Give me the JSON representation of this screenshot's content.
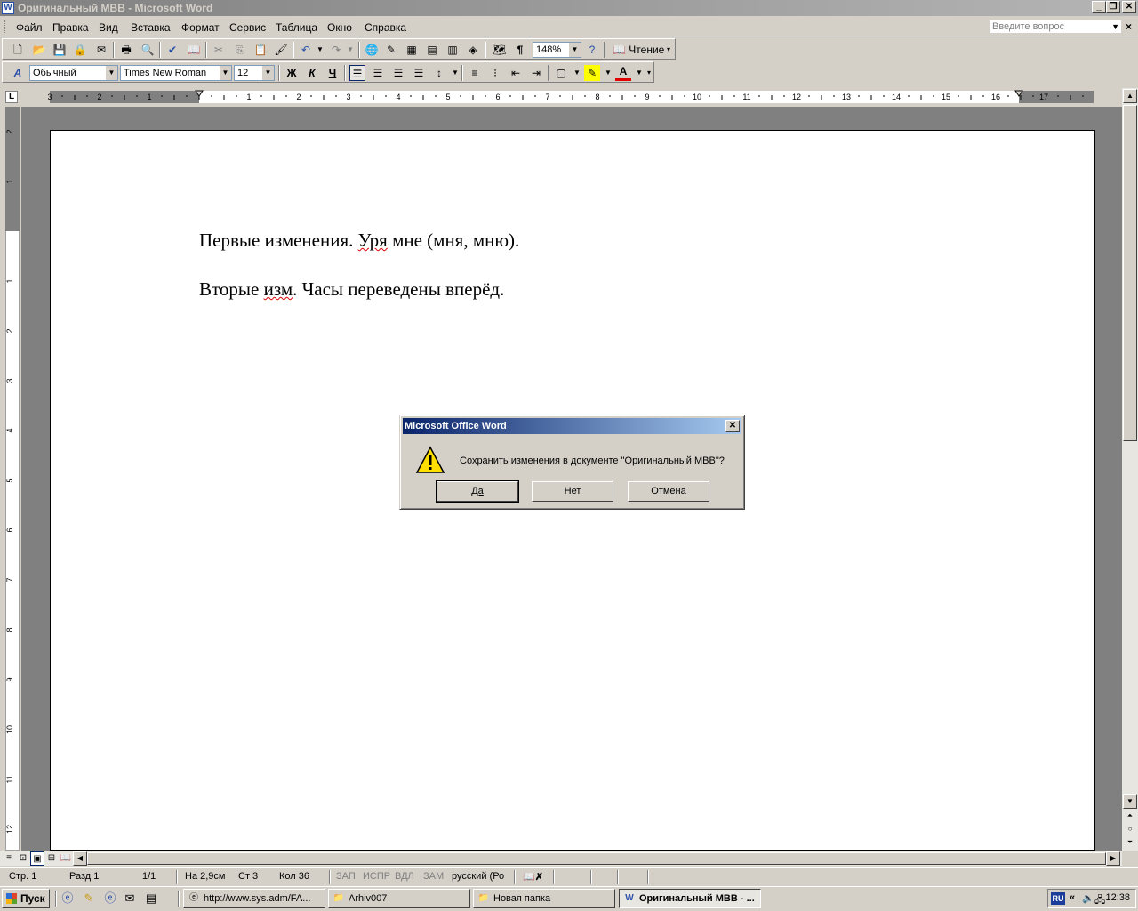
{
  "window": {
    "title": "Оригинальный МВВ - Microsoft Word",
    "icon": "word-icon"
  },
  "menu": {
    "items": [
      "Файл",
      "Правка",
      "Вид",
      "Вставка",
      "Формат",
      "Сервис",
      "Таблица",
      "Окно",
      "Справка"
    ],
    "help_placeholder": "Введите вопрос"
  },
  "toolbar_standard": {
    "zoom": "148%",
    "read_label": "Чтение"
  },
  "toolbar_format": {
    "style": "Обычный",
    "font": "Times New Roman",
    "size": "12",
    "bold": "Ж",
    "italic": "К",
    "underline": "Ч"
  },
  "ruler": {
    "h_labels": [
      "3",
      "2",
      "1",
      "1",
      "2",
      "3",
      "4",
      "5",
      "6",
      "7",
      "8",
      "9",
      "10",
      "11",
      "12",
      "13",
      "14",
      "15",
      "16",
      "17"
    ],
    "v_labels": [
      "2",
      "1",
      "1",
      "2",
      "3",
      "4",
      "5",
      "6",
      "7",
      "8",
      "9",
      "10",
      "11",
      "12"
    ]
  },
  "document": {
    "line1": {
      "before": "Первые изменения. ",
      "squiggly": "Уря",
      "after": " мне (мня, мню)."
    },
    "line2": {
      "before": "Вторые ",
      "squiggly": "изм",
      "after": ". Часы переведены вперёд."
    }
  },
  "dialog": {
    "title": "Microsoft Office Word",
    "message": "Сохранить изменения в документе \"Оригинальный МВВ\"?",
    "yes": "Да",
    "no": "Нет",
    "cancel": "Отмена",
    "icon": "warning-icon"
  },
  "statusbar": {
    "page": "Стр. 1",
    "section": "Разд 1",
    "pages": "1/1",
    "at": "На 2,9см",
    "line": "Ст 3",
    "col": "Кол 36",
    "rec": "ЗАП",
    "trk": "ИСПР",
    "ext": "ВДЛ",
    "ovr": "ЗАМ",
    "lang": "русский (Ро"
  },
  "taskbar": {
    "start": "Пуск",
    "tasks": [
      {
        "label": "http://www.sys.adm/FA...",
        "icon": "ie-icon"
      },
      {
        "label": "Arhiv007",
        "icon": "folder-icon"
      },
      {
        "label": "Новая папка",
        "icon": "folder-icon"
      },
      {
        "label": "Оригинальный МВВ - ...",
        "icon": "word-icon"
      }
    ],
    "lang": "RU",
    "time": "12:38"
  }
}
